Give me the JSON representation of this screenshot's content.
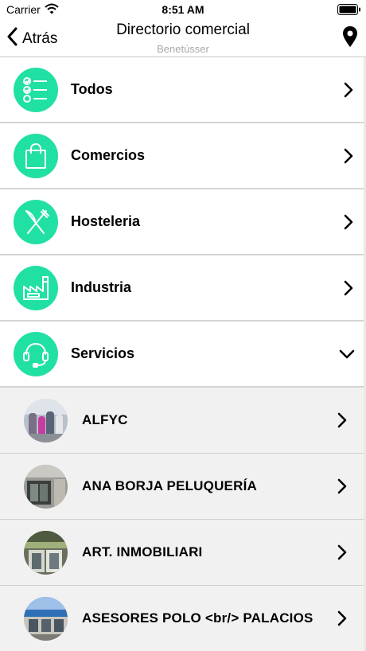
{
  "status_bar": {
    "carrier": "Carrier",
    "time": "8:51 AM"
  },
  "nav": {
    "back_label": "Atrás",
    "title": "Directorio comercial",
    "subtitle": "Benetússer"
  },
  "accent_color": "#21e0a3",
  "categories": [
    {
      "label": "Todos",
      "icon": "checklist-icon",
      "expanded": false
    },
    {
      "label": "Comercios",
      "icon": "shopping-bag-icon",
      "expanded": false
    },
    {
      "label": "Hosteleria",
      "icon": "fork-knife-icon",
      "expanded": false
    },
    {
      "label": "Industria",
      "icon": "factory-icon",
      "expanded": false
    },
    {
      "label": "Servicios",
      "icon": "headset-icon",
      "expanded": true
    }
  ],
  "businesses": [
    {
      "name": "ALFYC"
    },
    {
      "name": "ANA BORJA PELUQUERÍA"
    },
    {
      "name": "ART. INMOBILIARI"
    },
    {
      "name": "ASESORES POLO <br/> PALACIOS"
    }
  ]
}
